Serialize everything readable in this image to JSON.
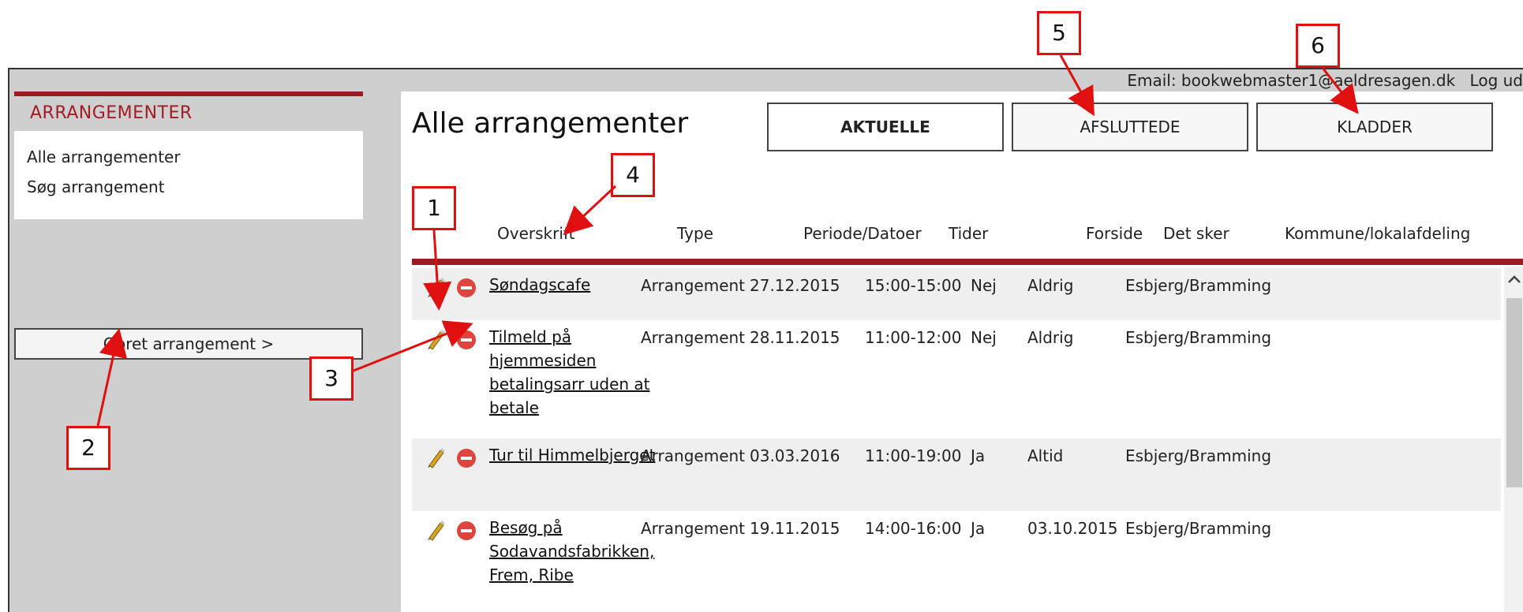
{
  "topbar": {
    "email": "Email: bookwebmaster1@aeldresagen.dk",
    "logout": "Log ud"
  },
  "sidebar": {
    "title": "ARRANGEMENTER",
    "items": [
      {
        "label": "Alle arrangementer"
      },
      {
        "label": "Søg arrangement"
      }
    ],
    "create_label": "Opret arrangement >"
  },
  "main": {
    "title": "Alle arrangementer",
    "tabs": [
      {
        "label": "AKTUELLE",
        "active": true
      },
      {
        "label": "AFSLUTTEDE",
        "active": false
      },
      {
        "label": "KLADDER",
        "active": false
      }
    ],
    "columns": [
      "Overskrift",
      "Type",
      "Periode/Datoer",
      "Tider",
      "Forside",
      "Det sker",
      "Kommune/lokalafdeling"
    ],
    "rows": [
      {
        "title": "Søndagscafe",
        "type": "Arrangement",
        "date": "27.12.2015",
        "time": "15:00-15:00",
        "frontpage": "Nej",
        "happens": "Aldrig",
        "area": "Esbjerg/Bramming"
      },
      {
        "title": "Tilmeld på hjemmesiden betalingsarr uden at betale",
        "type": "Arrangement",
        "date": "28.11.2015",
        "time": "11:00-12:00",
        "frontpage": "Nej",
        "happens": "Aldrig",
        "area": "Esbjerg/Bramming"
      },
      {
        "title": "Tur til Himmelbjerget",
        "type": "Arrangement",
        "date": "03.03.2016",
        "time": "11:00-19:00",
        "frontpage": "Ja",
        "happens": "Altid",
        "area": "Esbjerg/Bramming"
      },
      {
        "title": "Besøg på Sodavandsfabrikken, Frem, Ribe",
        "type": "Arrangement",
        "date": "19.11.2015",
        "time": "14:00-16:00",
        "frontpage": "Ja",
        "happens": "03.10.2015",
        "area": "Esbjerg/Bramming"
      }
    ]
  },
  "callouts": [
    "1",
    "2",
    "3",
    "4",
    "5",
    "6"
  ],
  "colors": {
    "accent": "#9c1b22",
    "callout": "#e01010",
    "panel": "#cfcfcf"
  }
}
